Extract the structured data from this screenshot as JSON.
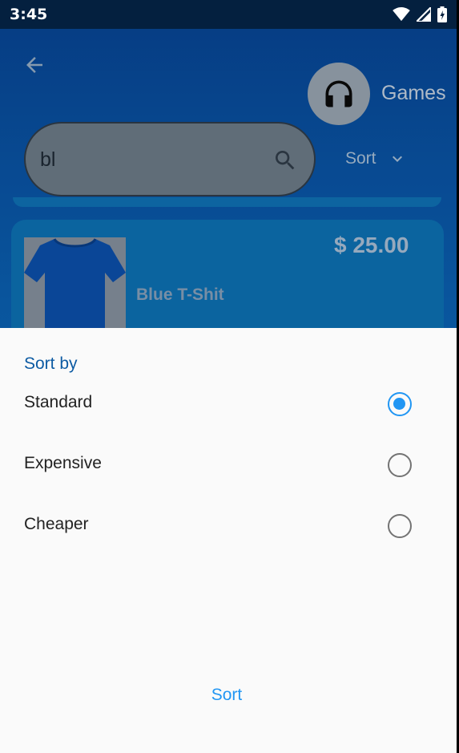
{
  "status_bar": {
    "time": "3:45",
    "icons": [
      "wifi-icon",
      "signal-icon",
      "battery-icon"
    ]
  },
  "header": {
    "back_icon": "arrow-left-icon",
    "category_icon": "headphones-icon",
    "category_label": "Games"
  },
  "search": {
    "value": "bl",
    "icon": "search-icon"
  },
  "sort_toggle": {
    "label": "Sort",
    "icon": "chevron-down-icon"
  },
  "product": {
    "name": "Blue T-Shit",
    "price": "$ 25.00"
  },
  "sheet": {
    "title": "Sort by",
    "options": [
      {
        "label": "Standard",
        "selected": true
      },
      {
        "label": "Expensive",
        "selected": false
      },
      {
        "label": "Cheaper",
        "selected": false
      }
    ],
    "button_label": "Sort"
  },
  "colors": {
    "accent": "#2196f3",
    "title": "#0d5ba3",
    "sheet_bg": "#fafafa",
    "app_bg": "#0a5aa6"
  }
}
